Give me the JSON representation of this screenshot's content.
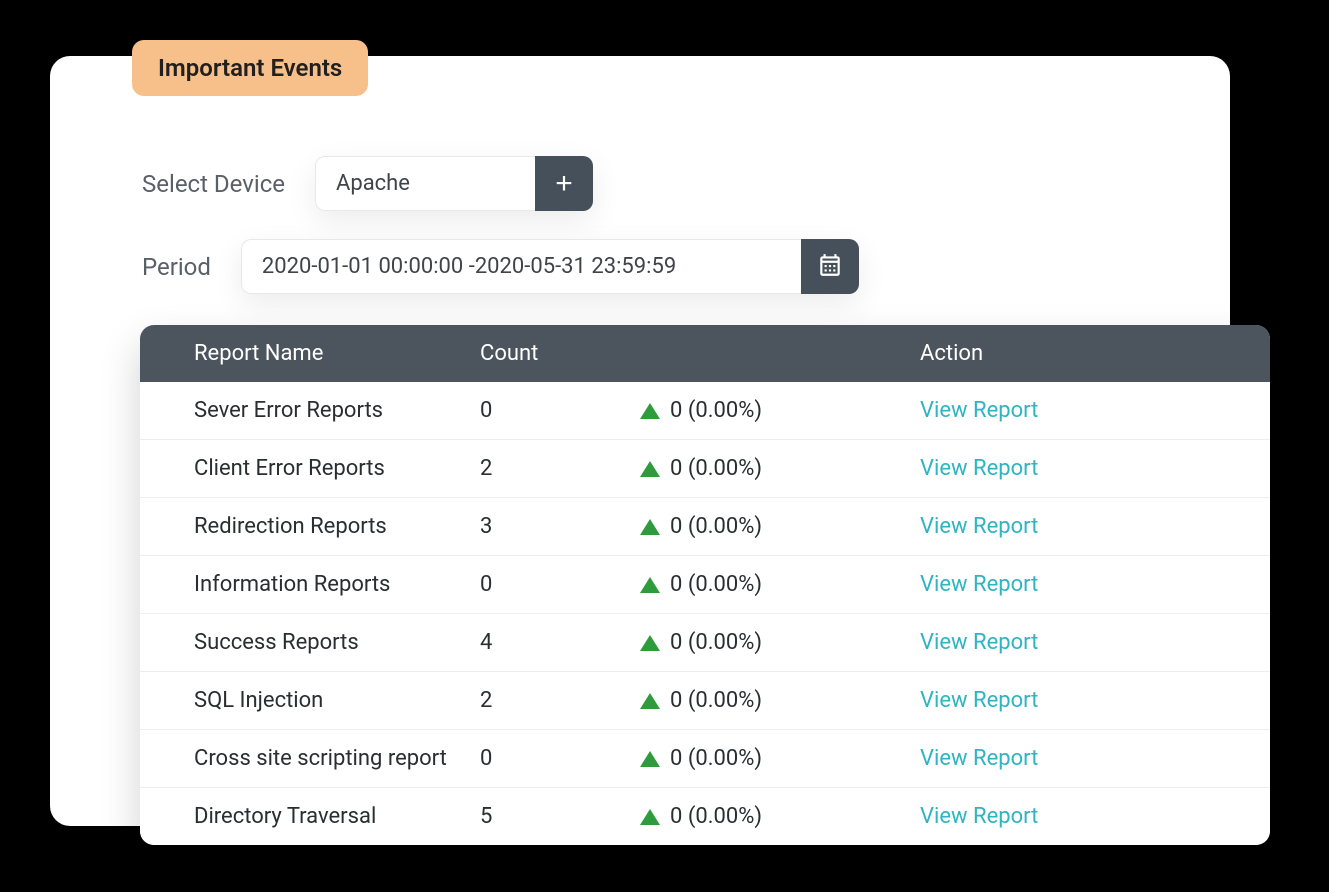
{
  "header": {
    "badge": "Important Events"
  },
  "controls": {
    "device_label": "Select Device",
    "device_value": "Apache",
    "period_label": "Period",
    "period_value": "2020-01-01 00:00:00 -2020-05-31 23:59:59"
  },
  "table": {
    "columns": {
      "name": "Report Name",
      "count": "Count",
      "action": "Action"
    },
    "action_label": "View Report",
    "rows": [
      {
        "name": "Sever Error Reports",
        "count": "0",
        "change": "0 (0.00%)"
      },
      {
        "name": "Client Error Reports",
        "count": "2",
        "change": "0 (0.00%)"
      },
      {
        "name": "Redirection Reports",
        "count": "3",
        "change": "0 (0.00%)"
      },
      {
        "name": "Information Reports",
        "count": "0",
        "change": "0 (0.00%)"
      },
      {
        "name": "Success Reports",
        "count": "4",
        "change": "0 (0.00%)"
      },
      {
        "name": "SQL Injection",
        "count": "2",
        "change": "0 (0.00%)"
      },
      {
        "name": "Cross site scripting report",
        "count": "0",
        "change": "0 (0.00%)"
      },
      {
        "name": "Directory Traversal",
        "count": "5",
        "change": "0 (0.00%)"
      }
    ]
  }
}
